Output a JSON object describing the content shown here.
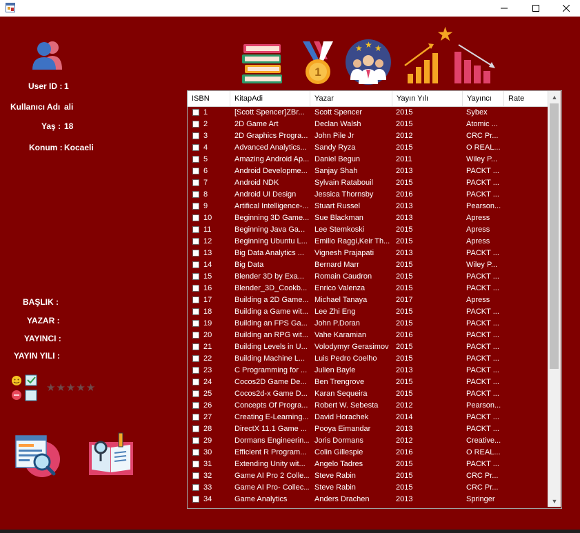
{
  "window": {
    "minimize_icon": "minimize-icon",
    "maximize_icon": "maximize-icon",
    "close_icon": "close-icon"
  },
  "profile": {
    "user_id_label": "User ID :",
    "user_id_value": "1",
    "username_label": "Kullanıcı Adı",
    "username_value": "ali",
    "age_label": "Yaş :",
    "age_value": "18",
    "location_label": "Konum :",
    "location_value": "Kocaeli"
  },
  "details": {
    "title_label": "BAŞLIK :",
    "author_label": "YAZAR :",
    "publisher_label": "YAYINCI :",
    "year_label": "YAYIN YILI :"
  },
  "toolbar": [
    "books-icon",
    "medal-icon",
    "users-rating-icon",
    "trend-chart-icon"
  ],
  "rating": {
    "stars": 5,
    "filled": 0
  },
  "grid": {
    "columns": [
      "ISBN",
      "KitapAdi",
      "Yazar",
      "Yayın Yılı",
      "Yayıncı",
      "Rate"
    ],
    "rows": [
      [
        "1",
        "[Scott Spencer]ZBr...",
        "Scott Spencer",
        "2015",
        "Sybex"
      ],
      [
        "2",
        "2D Game Art",
        "Declan Walsh",
        "2015",
        "Atomic ..."
      ],
      [
        "3",
        "2D Graphics Progra...",
        "John Pile Jr",
        "2012",
        "CRC Pr..."
      ],
      [
        "4",
        "Advanced Analytics...",
        "Sandy Ryza",
        "2015",
        "O REAL..."
      ],
      [
        "5",
        "Amazing Android Ap...",
        "Daniel Begun",
        "2011",
        "Wiley P..."
      ],
      [
        "6",
        "Android Developme...",
        "Sanjay Shah",
        "2013",
        "PACKT ..."
      ],
      [
        "7",
        "Android NDK",
        "Sylvain Ratabouil",
        "2015",
        "PACKT ..."
      ],
      [
        "8",
        "Android UI Design",
        "Jessica Thornsby",
        "2016",
        "PACKT ..."
      ],
      [
        "9",
        "Artifical Intelligence-...",
        "Stuart Russel",
        "2013",
        "Pearson..."
      ],
      [
        "10",
        "Beginning 3D Game...",
        "Sue Blackman",
        "2013",
        "Apress"
      ],
      [
        "11",
        "Beginning Java Ga...",
        "Lee Stemkoski",
        "2015",
        "Apress"
      ],
      [
        "12",
        "Beginning Ubuntu L...",
        "Emilio Raggi,Keir Th...",
        "2015",
        "Apress"
      ],
      [
        "13",
        "Big Data Analytics ...",
        "Vignesh Prajapati",
        "2013",
        "PACKT ..."
      ],
      [
        "14",
        "Big Data",
        "Bernard Marr",
        "2015",
        "Wiley P..."
      ],
      [
        "15",
        "Blender 3D by Exa...",
        "Romain Caudron",
        "2015",
        "PACKT ..."
      ],
      [
        "16",
        "Blender_3D_Cookb...",
        "Enrico Valenza",
        "2015",
        "PACKT ..."
      ],
      [
        "17",
        "Building a 2D Game...",
        "Michael Tanaya",
        "2017",
        "Apress"
      ],
      [
        "18",
        "Building a Game wit...",
        "Lee Zhi Eng",
        "2015",
        "PACKT ..."
      ],
      [
        "19",
        "Building an FPS Ga...",
        "John P.Doran",
        "2015",
        "PACKT ..."
      ],
      [
        "20",
        "Building an RPG wit...",
        "Vahe Karamian",
        "2016",
        "PACKT ..."
      ],
      [
        "21",
        "Building Levels in U...",
        "Volodymyr Gerasimov",
        "2015",
        "PACKT ..."
      ],
      [
        "22",
        "Building Machine L...",
        "Luis Pedro Coelho",
        "2015",
        "PACKT ..."
      ],
      [
        "23",
        "C Programming for ...",
        "Julien Bayle",
        "2013",
        "PACKT ..."
      ],
      [
        "24",
        "Cocos2D Game De...",
        "Ben Trengrove",
        "2015",
        "PACKT ..."
      ],
      [
        "25",
        "Cocos2d-x Game D...",
        "Karan Sequeira",
        "2015",
        "PACKT ..."
      ],
      [
        "26",
        "Concepts Of Progra...",
        "Robert W. Sebesta",
        "2012",
        "Pearson..."
      ],
      [
        "27",
        "Creating E-Learning...",
        "David Horachek",
        "2014",
        "PACKT ..."
      ],
      [
        "28",
        "DirectX 11.1 Game ...",
        "Pooya Eimandar",
        "2013",
        "PACKT ..."
      ],
      [
        "29",
        "Dormans Engineerin...",
        "Joris Dormans",
        "2012",
        "Creative..."
      ],
      [
        "30",
        "Efficient R Program...",
        "Colin Gillespie",
        "2016",
        "O REAL..."
      ],
      [
        "31",
        "Extending Unity wit...",
        "Angelo Tadres",
        "2015",
        "PACKT ..."
      ],
      [
        "32",
        "Game AI Pro 2 Colle...",
        "Steve Rabin",
        "2015",
        "CRC Pr..."
      ],
      [
        "33",
        "Game AI Pro- Collec...",
        "Steve Rabin",
        "2015",
        "CRC Pr..."
      ],
      [
        "34",
        "Game Analytics",
        "Anders Drachen",
        "2013",
        "Springer"
      ]
    ]
  }
}
